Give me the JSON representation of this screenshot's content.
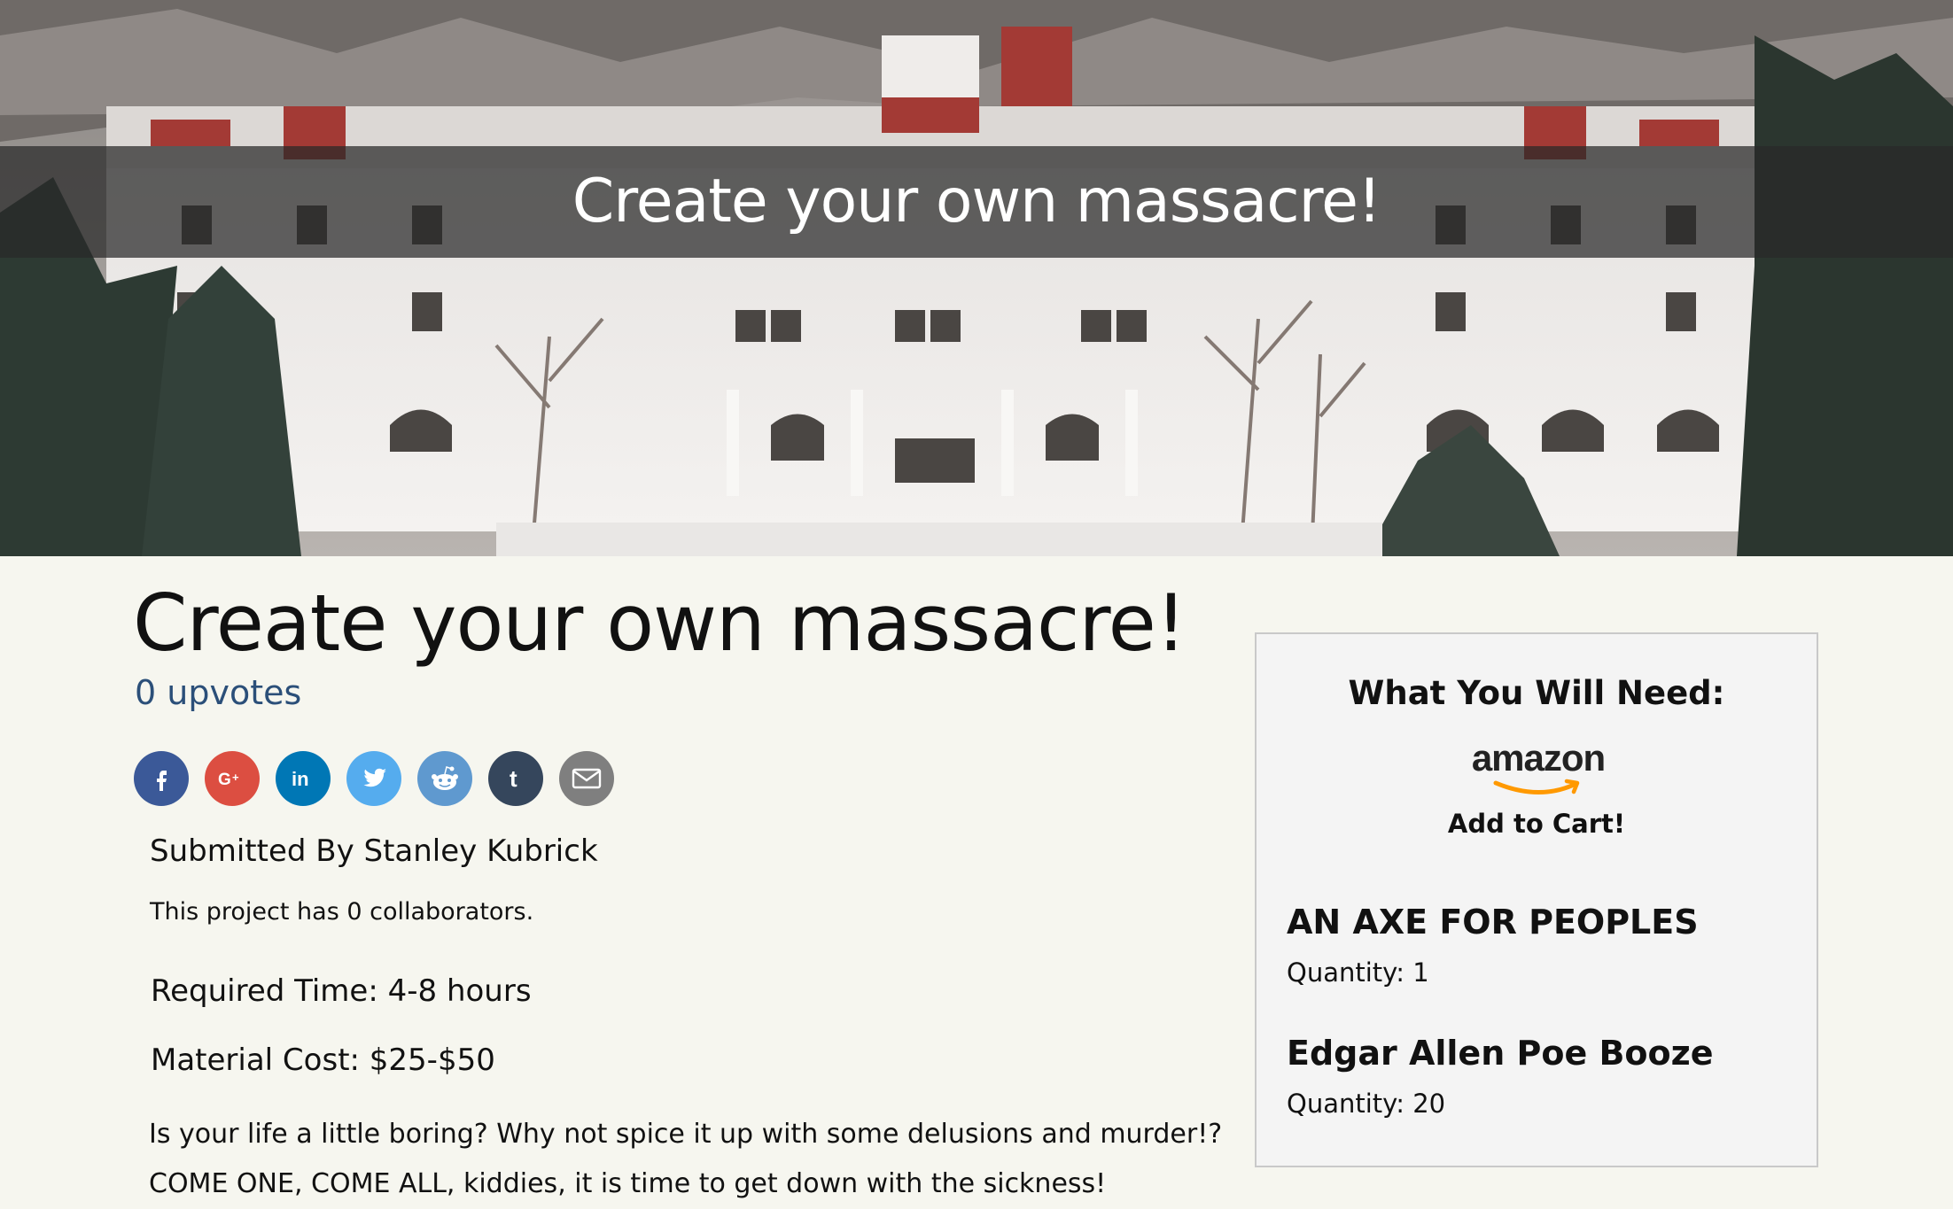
{
  "hero": {
    "title": "Create your own massacre!",
    "image_icon": "hotel-photo"
  },
  "project": {
    "title": "Create your own massacre!",
    "upvotes": "0 upvotes",
    "submitted_by": "Submitted By Stanley Kubrick",
    "collaborators": "This project has 0 collaborators.",
    "required_time": "Required Time: 4-8 hours",
    "material_cost": "Material Cost: $25-$50",
    "description": "Is your life a little boring? Why not spice it up with some delusions and murder!? COME ONE, COME ALL, kiddies, it is time to get down with the sickness!"
  },
  "share": [
    {
      "icon": "facebook-icon",
      "glyph": "f",
      "color": "#3b5998"
    },
    {
      "icon": "google-plus-icon",
      "glyph": "G+",
      "color": "#dc4e41"
    },
    {
      "icon": "linkedin-icon",
      "glyph": "in",
      "color": "#0077b5"
    },
    {
      "icon": "twitter-icon",
      "glyph": "bird",
      "color": "#55acee"
    },
    {
      "icon": "reddit-icon",
      "glyph": "alien",
      "color": "#5f99cf"
    },
    {
      "icon": "tumblr-icon",
      "glyph": "t",
      "color": "#35465c"
    },
    {
      "icon": "email-icon",
      "glyph": "envelope",
      "color": "#7f7f7f"
    }
  ],
  "sidebar": {
    "title": "What You Will Need:",
    "amazon_logo": "amazon",
    "add_to_cart": "Add to Cart!",
    "items": [
      {
        "name": "AN AXE FOR PEOPLES",
        "quantity": "Quantity: 1"
      },
      {
        "name": "Edgar Allen Poe Booze",
        "quantity": "Quantity: 20"
      }
    ]
  },
  "colors": {
    "page_bg": "#f6f6ef",
    "upvote_link": "#2b4f79",
    "amazon_orange": "#f90"
  }
}
